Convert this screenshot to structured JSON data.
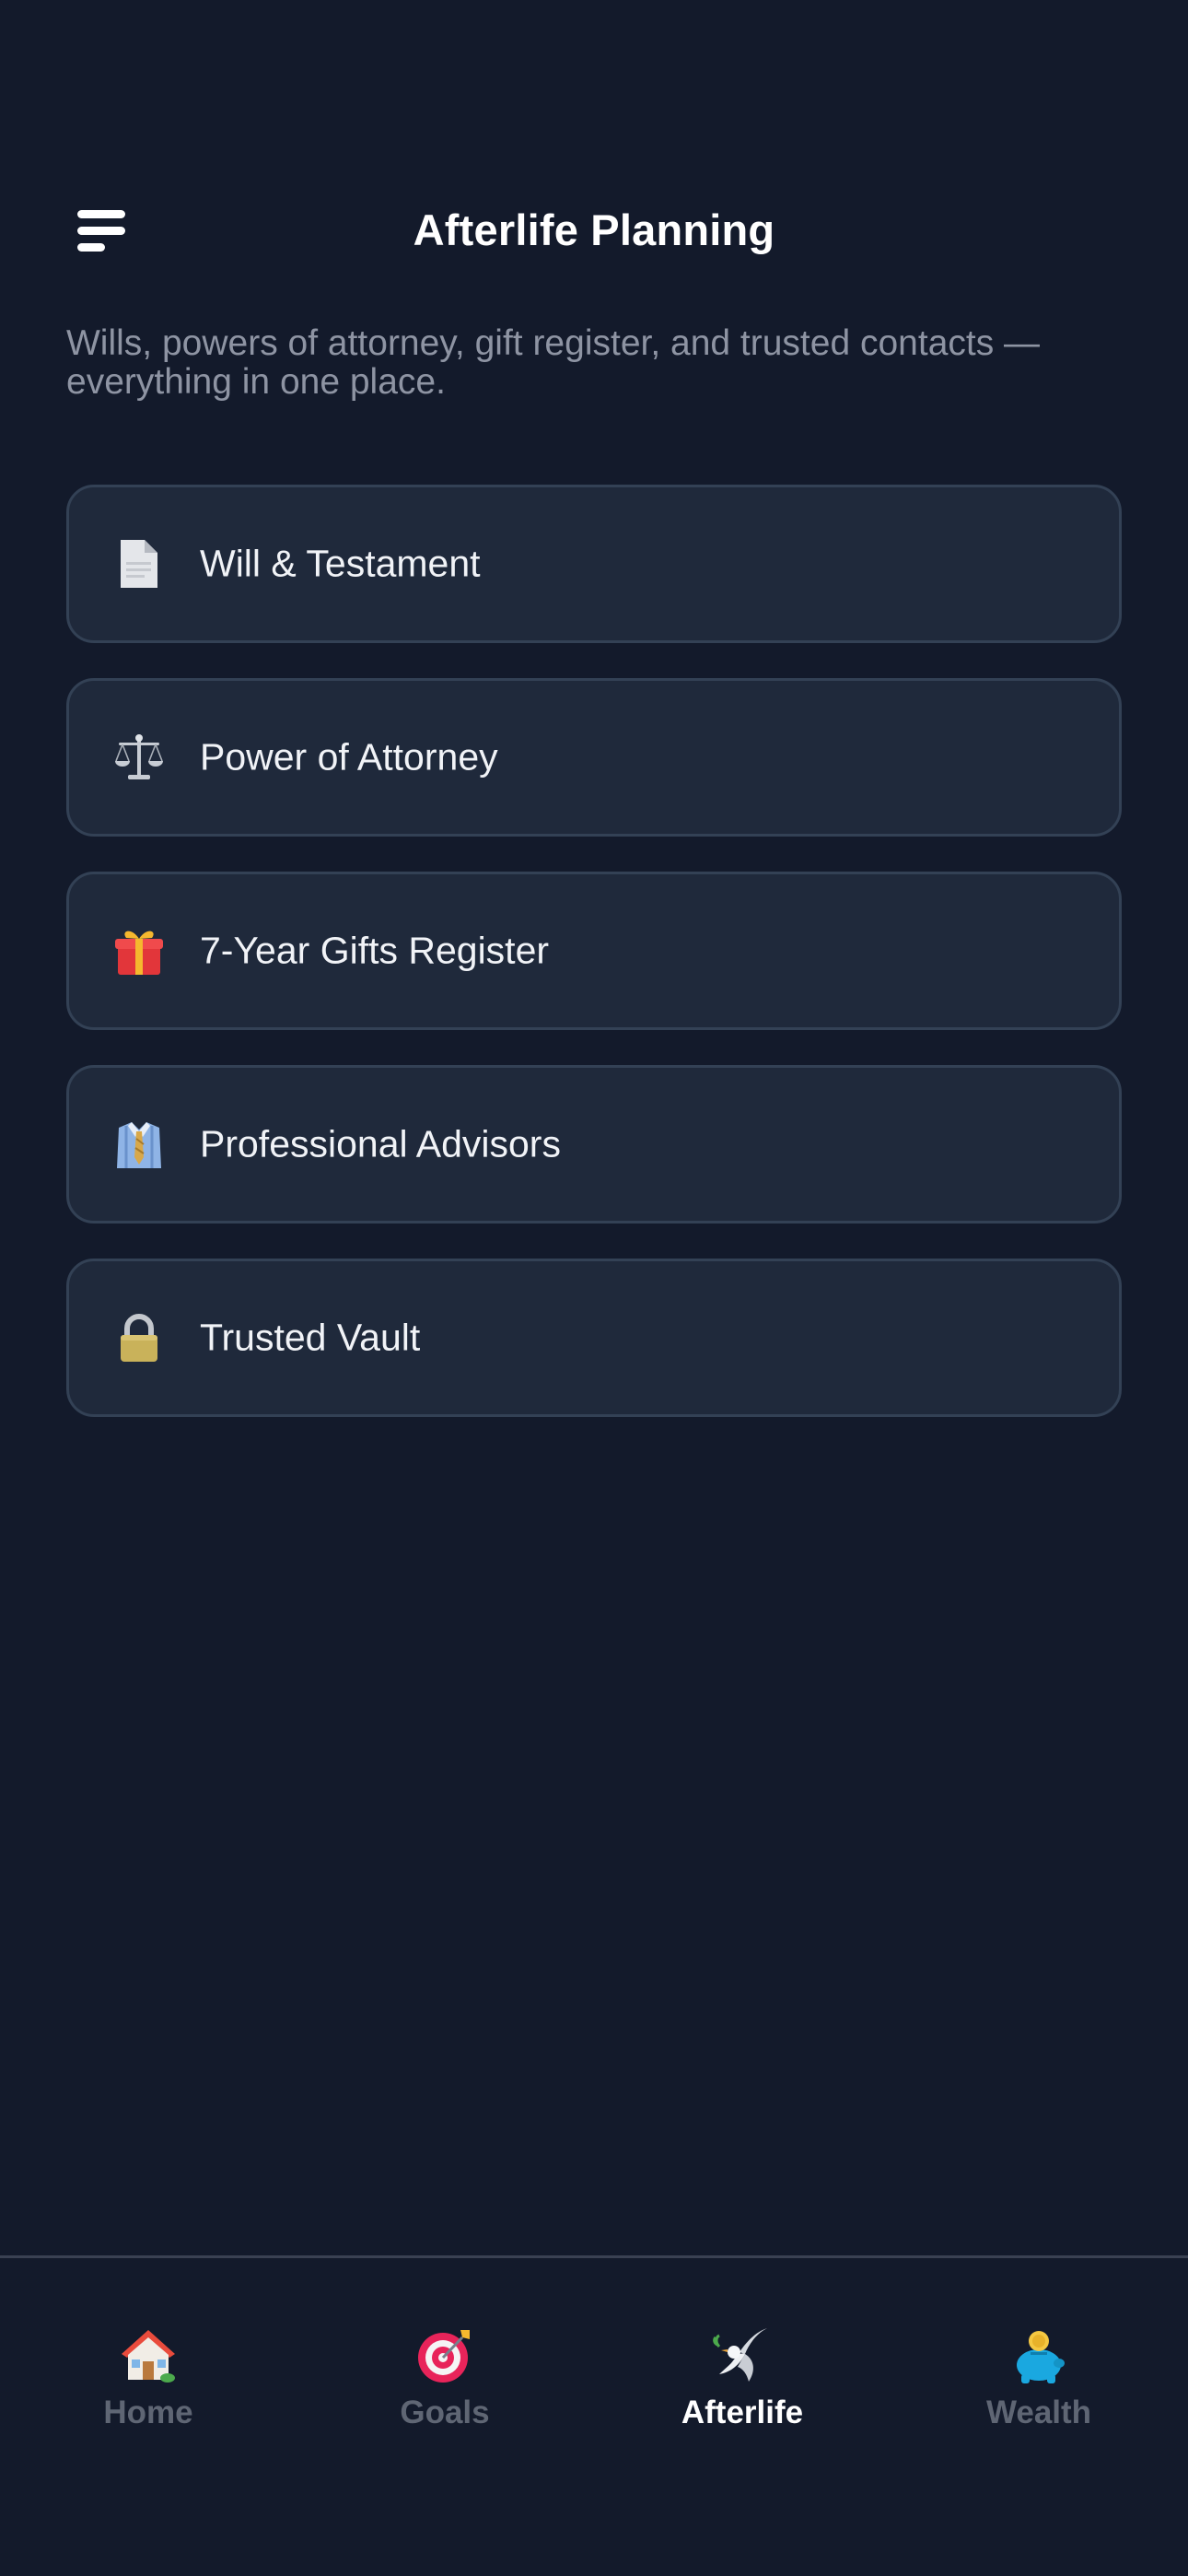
{
  "header": {
    "title": "Afterlife Planning",
    "menu_icon": "hamburger-menu-icon"
  },
  "intro": {
    "text": "Wills, powers of attorney, gift register, and trusted contacts — everything in one place."
  },
  "menu": {
    "items": [
      {
        "label": "Will & Testament",
        "icon": "document-icon"
      },
      {
        "label": "Power of Attorney",
        "icon": "scales-icon"
      },
      {
        "label": "7-Year Gifts Register",
        "icon": "gift-icon"
      },
      {
        "label": "Professional Advisors",
        "icon": "necktie-shirt-icon"
      },
      {
        "label": "Trusted Vault",
        "icon": "padlock-icon"
      }
    ]
  },
  "tabbar": {
    "items": [
      {
        "label": "Home",
        "icon": "house-icon",
        "active": false
      },
      {
        "label": "Goals",
        "icon": "target-icon",
        "active": false
      },
      {
        "label": "Afterlife",
        "icon": "dove-icon",
        "active": true
      },
      {
        "label": "Wealth",
        "icon": "piggy-bank-icon",
        "active": false
      }
    ]
  },
  "colors": {
    "background": "#131a2b",
    "card_background": "#1f293b",
    "card_border": "#334155",
    "muted_text": "#8e94a3",
    "inactive_tab": "#5f6674",
    "active_tab": "#ffffff"
  }
}
